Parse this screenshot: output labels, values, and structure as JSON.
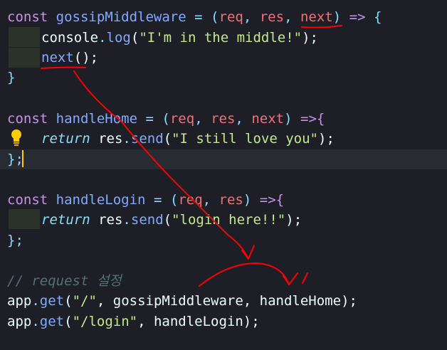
{
  "code_lines": {
    "l1": {
      "kw": "const",
      "name": "gossipMiddleware",
      "eq": "=",
      "open": "(",
      "p1": "req",
      "c1": ",",
      "p2": "res",
      "c2": ",",
      "p3": "next",
      "close": ")",
      "arrow": "=>",
      "brace": "{"
    },
    "l2": {
      "obj": "console",
      "dot": ".",
      "method": "log",
      "open": "(",
      "str": "\"I'm in the middle!\"",
      "close": ");"
    },
    "l3": {
      "fn": "next",
      "call": "();"
    },
    "l4": {
      "brace": "}"
    },
    "l6": {
      "kw": "const",
      "name": "handleHome",
      "eq": "=",
      "open": "(",
      "p1": "req",
      "c1": ",",
      "p2": "res",
      "c2": ",",
      "p3": "next",
      "close": ")",
      "arrow": "=>{"
    },
    "l7": {
      "ret": "return",
      "obj": "res",
      "dot": ".",
      "method": "send",
      "open": "(",
      "str": "\"I still love you\"",
      "close": ");"
    },
    "l8": {
      "text": "};"
    },
    "l10": {
      "kw": "const",
      "name": "handleLogin",
      "eq": "=",
      "open": "(",
      "p1": "req",
      "c1": ",",
      "p2": "res",
      "close": ")",
      "arrow": "=>{"
    },
    "l11": {
      "ret": "return",
      "obj": "res",
      "dot": ".",
      "method": "send",
      "open": "(",
      "str": "\"login here!!\"",
      "close": ");"
    },
    "l12": {
      "text": "};"
    },
    "l14": {
      "comment": "// request 설정"
    },
    "l15": {
      "obj": "app",
      "dot": ".",
      "method": "get",
      "open": "(",
      "str": "\"/\"",
      "rest": ", gossipMiddleware, handleHome",
      "close": ");"
    },
    "l16": {
      "obj": "app",
      "dot": ".",
      "method": "get",
      "open": "(",
      "str": "\"/login\"",
      "rest": ", handleLogin",
      "close": ");"
    }
  },
  "icons": {
    "lightbulb": "lightbulb-icon"
  },
  "colors": {
    "background": "#1e1f26",
    "keyword": "#c792ea",
    "function": "#82aaff",
    "param": "#f07178",
    "string": "#c3e88d",
    "punctuation": "#89ddff",
    "annotation": "#ff0000",
    "cursor": "#ffcc00"
  }
}
